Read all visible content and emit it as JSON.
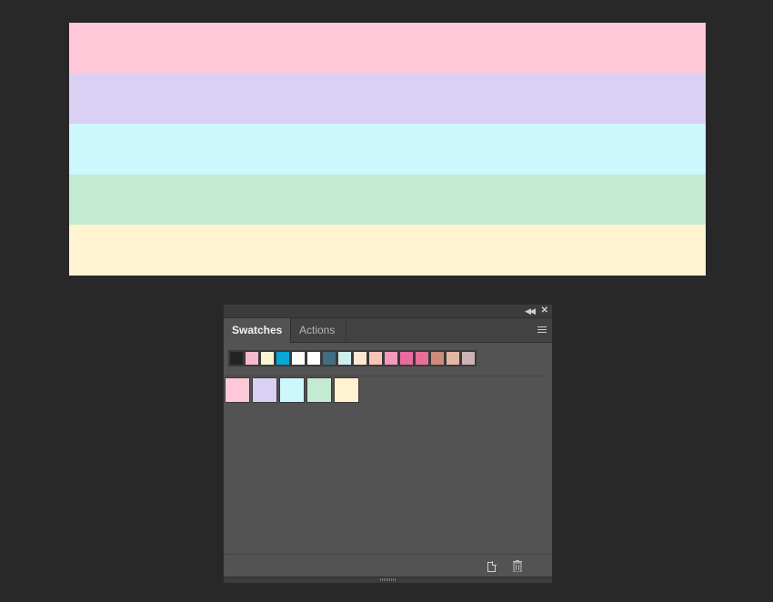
{
  "canvas": {
    "stripes": [
      {
        "name": "pink",
        "color": "#ffc8d8"
      },
      {
        "name": "lavender",
        "color": "#d9d0f3"
      },
      {
        "name": "light-cyan",
        "color": "#ccf7fd"
      },
      {
        "name": "mint",
        "color": "#c4ebd1"
      },
      {
        "name": "cream",
        "color": "#fff3d1"
      }
    ]
  },
  "panel": {
    "tabs": [
      {
        "label": "Swatches",
        "active": true
      },
      {
        "label": "Actions",
        "active": false
      }
    ],
    "default_swatches": [
      "#232323",
      "#f7b8cd",
      "#fbf6d2",
      "#05a7d8",
      "#ffffff",
      "#ffffff",
      "#436d82",
      "#cdf0ee",
      "#fce8d1",
      "#f8c4b6",
      "#f299bb",
      "#e96aa0",
      "#e76f98",
      "#cf8b7b",
      "#e6b6a4",
      "#cbb4b6"
    ],
    "custom_swatches": [
      "#ffc8d8",
      "#d9d0f3",
      "#ccf7fd",
      "#c4ebd1",
      "#fff3d1"
    ],
    "icons": {
      "collapse": "double-chevron-left-icon",
      "close": "close-icon",
      "menu": "panel-menu-icon",
      "new_swatch": "new-swatch-icon",
      "delete": "trash-icon"
    }
  }
}
